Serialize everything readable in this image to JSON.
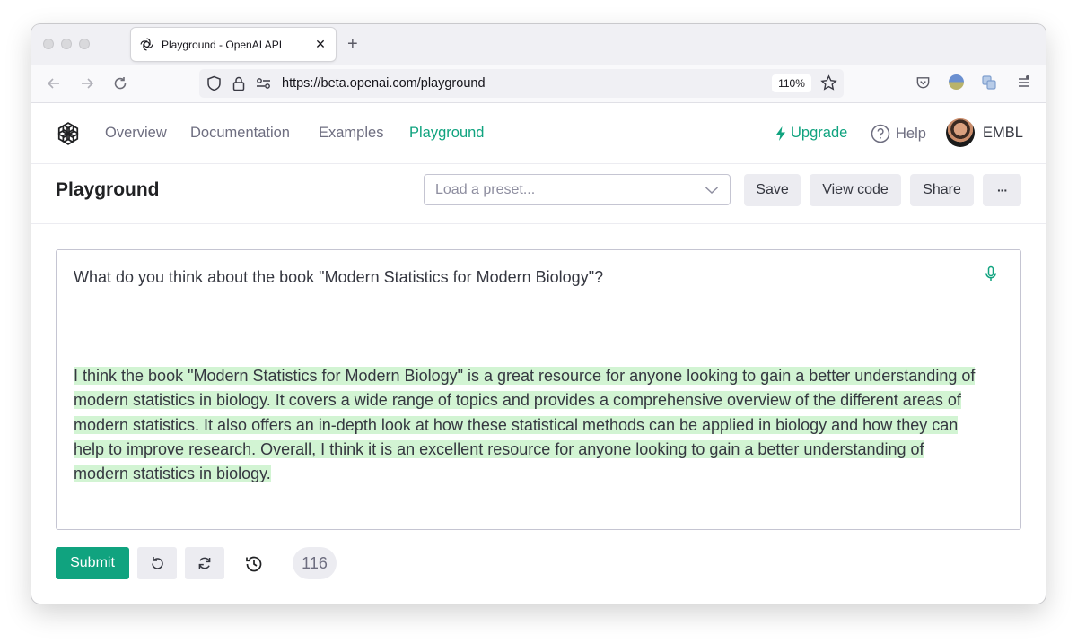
{
  "browser": {
    "tab_title": "Playground - OpenAI API",
    "url": "https://beta.openai.com/playground",
    "zoom": "110%"
  },
  "header": {
    "nav": [
      "Overview",
      "Documentation",
      "Examples",
      "Playground"
    ],
    "active_nav": "Playground",
    "upgrade": "Upgrade",
    "help": "Help",
    "org": "EMBL"
  },
  "toolbar": {
    "title": "Playground",
    "preset_placeholder": "Load a preset...",
    "save": "Save",
    "view_code": "View code",
    "share": "Share",
    "more": "···"
  },
  "editor": {
    "prompt": "What do you think about the book \"Modern Statistics for Modern Biology\"?",
    "completion": "I think the book \"Modern Statistics for Modern Biology\" is a great resource for anyone looking to gain a better understanding of modern statistics in biology. It covers a wide range of topics and provides a comprehensive overview of the different areas of modern statistics. It also offers an in-depth look at how these statistical methods can be applied in biology and how they can help to improve research. Overall, I think it is an excellent resource for anyone looking to gain a better understanding of modern statistics in biology."
  },
  "footer": {
    "submit": "Submit",
    "token_count": "116"
  },
  "colors": {
    "accent": "#10a37f",
    "highlight": "#d2f4d3"
  }
}
